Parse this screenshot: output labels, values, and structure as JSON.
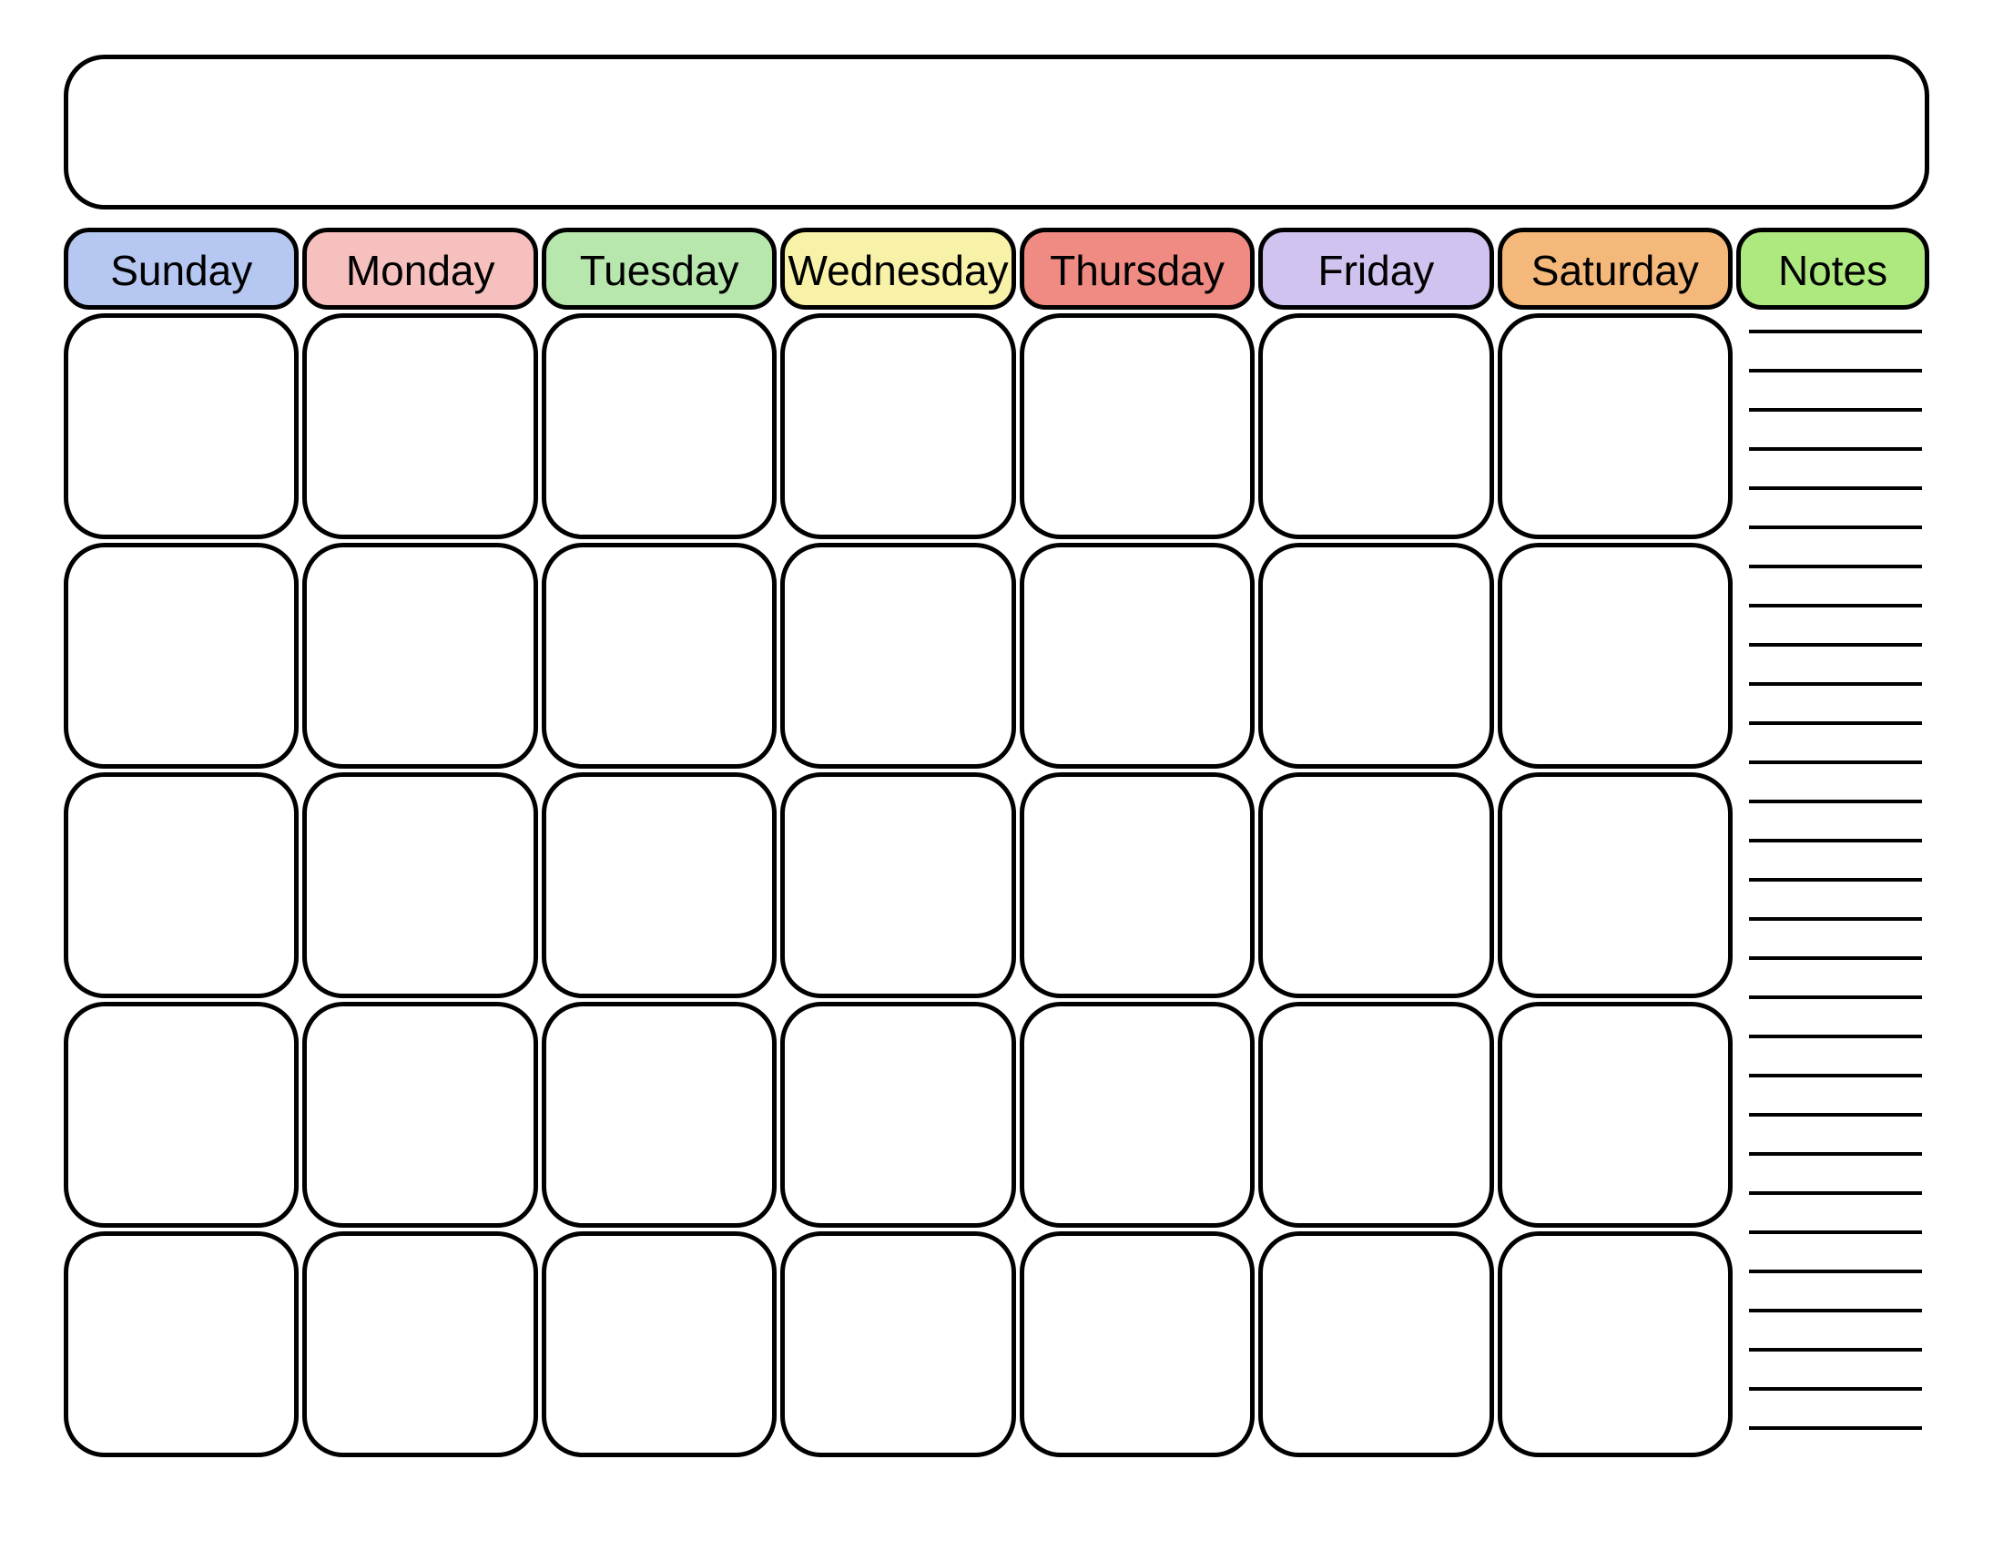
{
  "title": "",
  "headers": [
    {
      "label": "Sunday",
      "color": "#b6c7f1"
    },
    {
      "label": "Monday",
      "color": "#f6c0be"
    },
    {
      "label": "Tuesday",
      "color": "#b7e7ad"
    },
    {
      "label": "Wednesday",
      "color": "#f7f2a7"
    },
    {
      "label": "Thursday",
      "color": "#f08b84"
    },
    {
      "label": "Friday",
      "color": "#d1c3f0"
    },
    {
      "label": "Saturday",
      "color": "#f4b87a"
    }
  ],
  "notes_header": {
    "label": "Notes",
    "color": "#aee97f"
  },
  "grid": {
    "rows": 5,
    "cols": 7,
    "cells": [
      [
        "",
        "",
        "",
        "",
        "",
        "",
        ""
      ],
      [
        "",
        "",
        "",
        "",
        "",
        "",
        ""
      ],
      [
        "",
        "",
        "",
        "",
        "",
        "",
        ""
      ],
      [
        "",
        "",
        "",
        "",
        "",
        "",
        ""
      ],
      [
        "",
        "",
        "",
        "",
        "",
        "",
        ""
      ]
    ]
  },
  "notes_lines_count": 29,
  "notes_lines": [
    "",
    "",
    "",
    "",
    "",
    "",
    "",
    "",
    "",
    "",
    "",
    "",
    "",
    "",
    "",
    "",
    "",
    "",
    "",
    "",
    "",
    "",
    "",
    "",
    "",
    "",
    "",
    "",
    ""
  ]
}
